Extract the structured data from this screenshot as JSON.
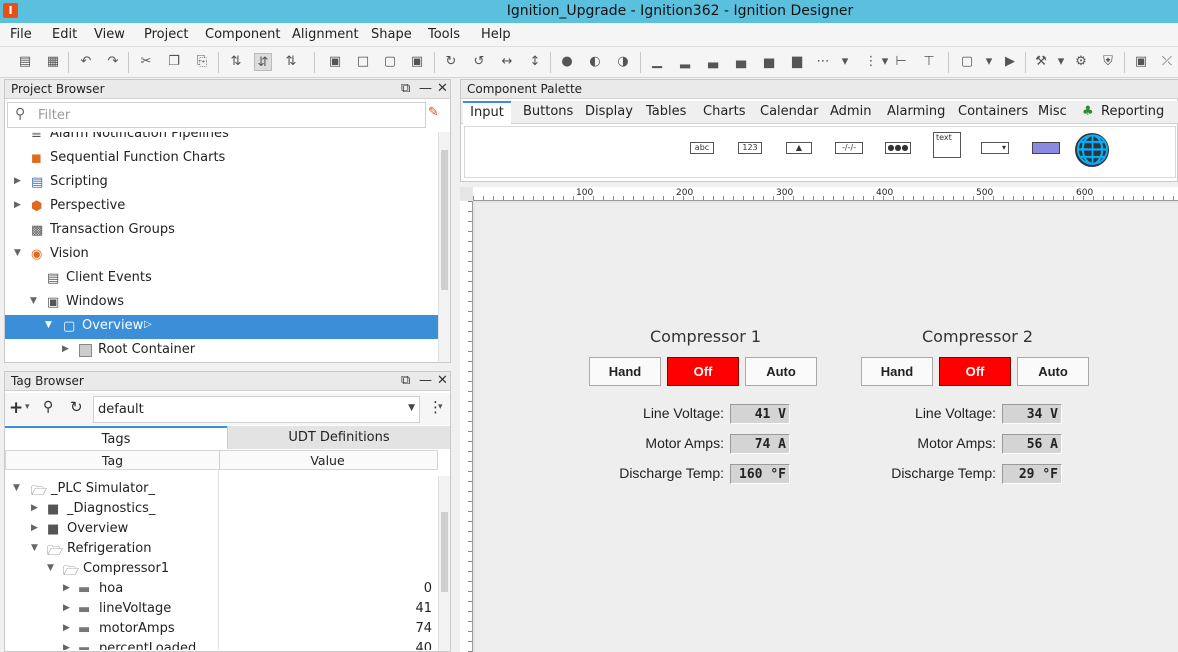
{
  "titlebar": {
    "title": "Ignition_Upgrade - Ignition362 - Ignition Designer"
  },
  "menu": [
    "File",
    "Edit",
    "View",
    "Project",
    "Component",
    "Alignment",
    "Shape",
    "Tools",
    "Help"
  ],
  "project_browser": {
    "title": "Project Browser",
    "filter_placeholder": "Filter",
    "items": [
      {
        "label": "Alarm Notification Pipelines"
      },
      {
        "label": "Sequential Function Charts"
      },
      {
        "label": "Scripting"
      },
      {
        "label": "Perspective"
      },
      {
        "label": "Transaction Groups"
      },
      {
        "label": "Vision"
      },
      {
        "label": "Client Events"
      },
      {
        "label": "Windows"
      },
      {
        "label": "Overview"
      },
      {
        "label": "Root Container"
      }
    ]
  },
  "tag_browser": {
    "title": "Tag Browser",
    "provider": "default",
    "tabs": [
      "Tags",
      "UDT Definitions"
    ],
    "columns": [
      "Tag",
      "Value"
    ],
    "rows": [
      {
        "label": "_PLC Simulator_",
        "value": ""
      },
      {
        "label": "_Diagnostics_",
        "value": ""
      },
      {
        "label": "Overview",
        "value": ""
      },
      {
        "label": "Refrigeration",
        "value": ""
      },
      {
        "label": "Compressor1",
        "value": ""
      },
      {
        "label": "hoa",
        "value": "0"
      },
      {
        "label": "lineVoltage",
        "value": "41"
      },
      {
        "label": "motorAmps",
        "value": "74"
      },
      {
        "label": "percentLoaded",
        "value": "40"
      }
    ]
  },
  "palette": {
    "title": "Component Palette",
    "tabs": [
      "Input",
      "Buttons",
      "Display",
      "Tables",
      "Charts",
      "Calendar",
      "Admin",
      "Alarming",
      "Containers",
      "Misc",
      "Reporting"
    ],
    "selected_tab": "Input",
    "icon_labels": {
      "text_field": "abc",
      "numeric": "123",
      "text_area": "text"
    }
  },
  "ruler": {
    "marks": [
      "100",
      "200",
      "300",
      "400",
      "500",
      "600"
    ]
  },
  "compressors": [
    {
      "title": "Compressor 1",
      "hand": "Hand",
      "off": "Off",
      "auto": "Auto",
      "voltage_label": "Line Voltage:",
      "voltage": "41 V",
      "amps_label": "Motor Amps:",
      "amps": "74 A",
      "temp_label": "Discharge Temp:",
      "temp": "160 °F"
    },
    {
      "title": "Compressor 2",
      "hand": "Hand",
      "off": "Off",
      "auto": "Auto",
      "voltage_label": "Line Voltage:",
      "voltage": "34 V",
      "amps_label": "Motor Amps:",
      "amps": "56 A",
      "temp_label": "Discharge Temp:",
      "temp": "29 °F"
    }
  ],
  "colors": {
    "accent": "#3a8fd8",
    "titlebar": "#5bc0de",
    "off_active": "#ff0000"
  }
}
